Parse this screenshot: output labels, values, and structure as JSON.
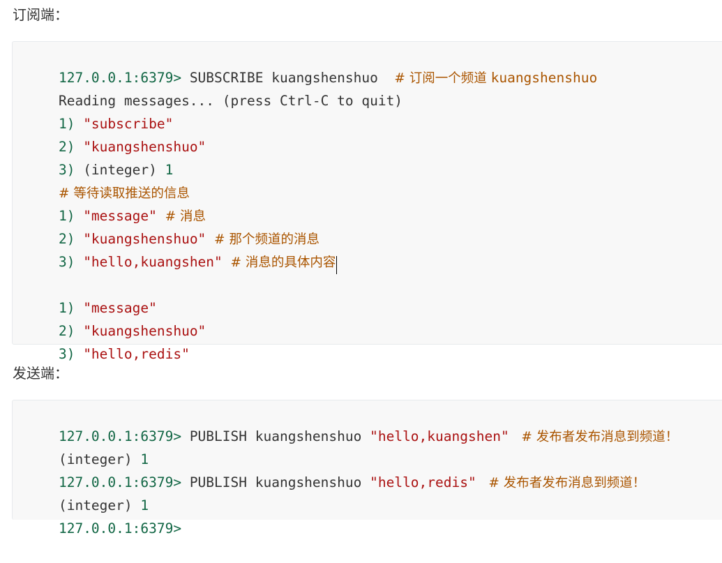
{
  "subscriber_heading": "订阅端：",
  "publisher_heading": "发送端：",
  "subscriber_block": {
    "lines": [
      {
        "prompt": "127.0.0.1:6379>",
        "cmd": " SUBSCRIBE kuangshenshuo  ",
        "comment": "# 订阅一个频道 ",
        "comment_code": "kuangshenshuo"
      },
      {
        "text": "Reading messages... (press Ctrl-C to quit)"
      },
      {
        "num": "1)",
        "str": " \"subscribe\""
      },
      {
        "num": "2)",
        "str": " \"kuangshenshuo\""
      },
      {
        "num": "3)",
        "plain": " (integer) ",
        "val": "1"
      },
      {
        "comment": "# 等待读取推送的信息"
      },
      {
        "num": "1)",
        "str": " \"message\"",
        "comment": "  # 消息"
      },
      {
        "num": "2)",
        "str": " \"kuangshenshuo\"",
        "comment": "  # 那个频道的消息"
      },
      {
        "num": "3)",
        "str": " \"hello,kuangshen\"",
        "comment": "  # 消息的具体内容"
      },
      {
        "num": "1)",
        "str": " \"message\""
      },
      {
        "num": "2)",
        "str": " \"kuangshenshuo\""
      },
      {
        "num": "3)",
        "str": " \"hello,redis\""
      }
    ]
  },
  "publisher_block": {
    "lines": [
      {
        "prompt": "127.0.0.1:6379>",
        "cmd": " PUBLISH kuangshenshuo ",
        "str": "\"hello,kuangshen\"",
        "comment": "   # 发布者发布消息到频道！"
      },
      {
        "plain": "(integer) ",
        "val": "1"
      },
      {
        "prompt": "127.0.0.1:6379>",
        "cmd": " PUBLISH kuangshenshuo ",
        "str": "\"hello,redis\"",
        "comment": "   # 发布者发布消息到频道！"
      },
      {
        "plain": "(integer) ",
        "val": "1"
      },
      {
        "prompt": "127.0.0.1:6379>"
      }
    ]
  }
}
